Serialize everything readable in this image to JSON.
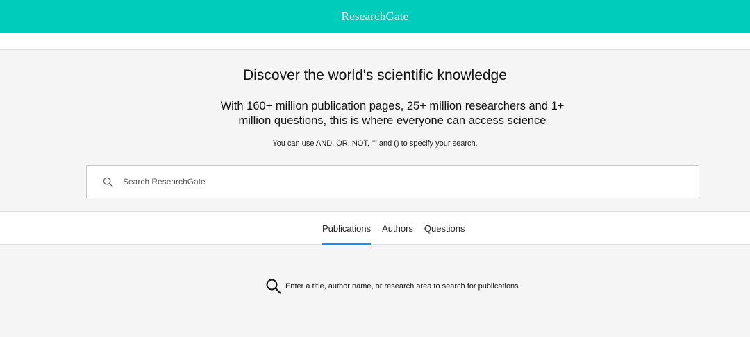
{
  "header": {
    "brand": "ResearchGate",
    "background": "#00ccbb"
  },
  "hero": {
    "headline": "Discover the world's scientific knowledge",
    "subhead_line1": "With 160+ million publication pages, 25+ million researchers and 1+",
    "subhead_line2": "million questions, this is where everyone can access science",
    "hint": "You can use AND, OR, NOT, \"\" and () to specify your search."
  },
  "search": {
    "icon": "search-icon",
    "placeholder": "Search ResearchGate",
    "value": ""
  },
  "tabs": [
    {
      "label": "Publications",
      "active": true
    },
    {
      "label": "Authors",
      "active": false
    },
    {
      "label": "Questions",
      "active": false
    }
  ],
  "empty_state": {
    "icon": "search-icon",
    "message": "Enter a title, author name, or research area to search for publications"
  },
  "colors": {
    "accent": "#00ccbb",
    "active_tab_underline": "#1a8cff"
  }
}
